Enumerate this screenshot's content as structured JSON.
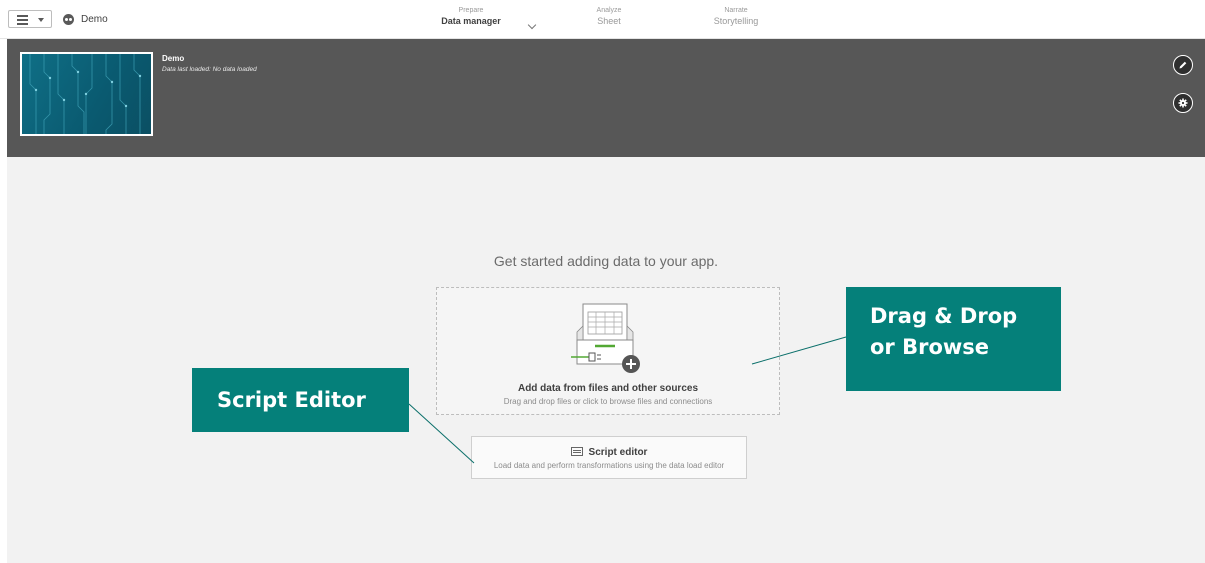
{
  "topbar": {
    "app_name": "Demo",
    "nav": {
      "prepare": {
        "sub": "Prepare",
        "main": "Data manager"
      },
      "analyze": {
        "sub": "Analyze",
        "main": "Sheet"
      },
      "narrate": {
        "sub": "Narrate",
        "main": "Storytelling"
      }
    }
  },
  "header": {
    "title": "Demo",
    "status": "Data last loaded: No data loaded"
  },
  "main": {
    "get_started": "Get started adding data to your app.",
    "add_data": {
      "title": "Add data from files and other sources",
      "subtitle": "Drag and drop files or click to browse files and connections"
    },
    "script_editor": {
      "title": "Script editor",
      "subtitle": "Load data and perform transformations using the data load editor"
    }
  },
  "callouts": {
    "drag_drop_line1": "Drag & Drop",
    "drag_drop_line2": "or Browse",
    "script_editor": "Script Editor"
  },
  "colors": {
    "header_band": "#575757",
    "callout": "#05807a",
    "accent_green": "#52a833",
    "background": "#f2f2f2"
  },
  "icons": [
    "hamburger-menu-icon",
    "app-icon",
    "chevron-down-icon",
    "edit-pencil-icon",
    "settings-gear-icon",
    "add-data-illustration",
    "script-editor-icon"
  ]
}
